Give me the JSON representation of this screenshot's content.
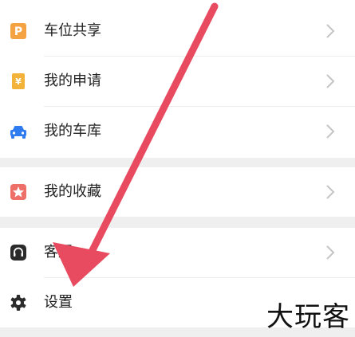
{
  "menu": {
    "group1": [
      {
        "label": "车位共享",
        "icon": "parking-icon"
      },
      {
        "label": "我的申请",
        "icon": "voucher-icon"
      },
      {
        "label": "我的车库",
        "icon": "car-icon"
      }
    ],
    "group2": [
      {
        "label": "我的收藏",
        "icon": "star-icon"
      }
    ],
    "group3": [
      {
        "label": "客服",
        "icon": "headset-icon"
      },
      {
        "label": "设置",
        "icon": "gear-icon"
      }
    ]
  },
  "watermark": "大玩客",
  "colors": {
    "parking": "#f5a243",
    "voucher": "#f3b23a",
    "car": "#2f7cf0",
    "star": "#ee6f67",
    "dark": "#2b2b2b",
    "arrow": "#e84a5f"
  }
}
